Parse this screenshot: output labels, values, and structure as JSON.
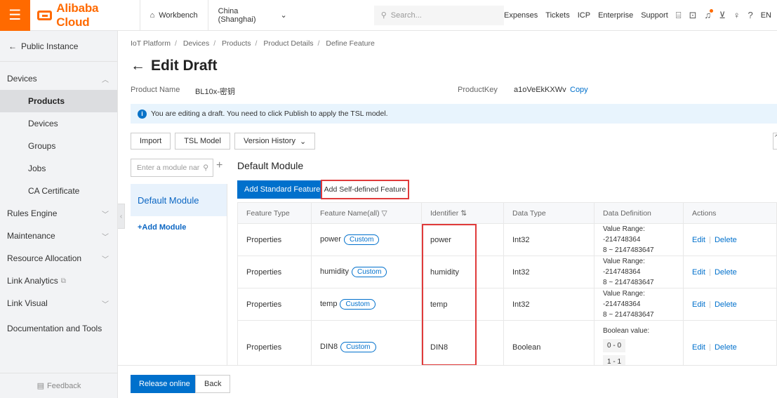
{
  "topbar": {
    "brand": "Alibaba Cloud",
    "workbench": "Workbench",
    "region": "China (Shanghai)",
    "search_placeholder": "Search...",
    "links": [
      "Expenses",
      "Tickets",
      "ICP",
      "Enterprise",
      "Support"
    ],
    "lang": "EN",
    "icons": [
      "code-icon",
      "terminal-icon",
      "bell-icon",
      "cart-icon",
      "lightbulb-icon",
      "help-icon"
    ]
  },
  "sidebar": {
    "back": "Public Instance",
    "groups": [
      {
        "label": "Devices",
        "expanded": true
      },
      {
        "label": "Rules Engine"
      },
      {
        "label": "Maintenance"
      },
      {
        "label": "Resource Allocation"
      },
      {
        "label": "Link Analytics"
      },
      {
        "label": "Link Visual"
      },
      {
        "label": "Documentation and Tools"
      }
    ],
    "sub_items": [
      "Products",
      "Devices",
      "Groups",
      "Jobs",
      "CA Certificate"
    ],
    "active_sub": "Products",
    "feedback": "Feedback"
  },
  "breadcrumb": [
    "IoT Platform",
    "Devices",
    "Products",
    "Product Details",
    "Define Feature"
  ],
  "page_title": "Edit Draft",
  "product": {
    "name_label": "Product Name",
    "name": "BL10x-密钥",
    "key_label": "ProductKey",
    "key": "a1oVeEkKXWv",
    "copy": "Copy"
  },
  "notice": "You are editing a draft. You need to click Publish to apply the TSL model.",
  "toolbar": {
    "import": "Import",
    "tsl_model": "TSL Model",
    "version_history": "Version History"
  },
  "modules": {
    "search_placeholder": "Enter a module nar",
    "active": "Default Module",
    "add": "+Add Module"
  },
  "module_content": {
    "title": "Default Module",
    "add_standard": "Add Standard Feature",
    "add_self_defined": "Add Self-defined Feature"
  },
  "table": {
    "headers": [
      "Feature Type",
      "Feature Name(all)",
      "Identifier",
      "Data Type",
      "Data Definition",
      "Actions"
    ],
    "rows": [
      {
        "type": "Properties",
        "name": "power",
        "tag": "Custom",
        "identifier": "power",
        "data_type": "Int32",
        "definition": "Value Range: -214748364",
        "definition2": "8 ~ 2147483647"
      },
      {
        "type": "Properties",
        "name": "humidity",
        "tag": "Custom",
        "identifier": "humidity",
        "data_type": "Int32",
        "definition": "Value Range: -214748364",
        "definition2": "8 ~ 2147483647"
      },
      {
        "type": "Properties",
        "name": "temp",
        "tag": "Custom",
        "identifier": "temp",
        "data_type": "Int32",
        "definition": "Value Range: -214748364",
        "definition2": "8 ~ 2147483647"
      },
      {
        "type": "Properties",
        "name": "DIN8",
        "tag": "Custom",
        "identifier": "DIN8",
        "data_type": "Boolean",
        "definition": "Boolean value:",
        "bool0": "0 - 0",
        "bool1": "1 - 1"
      }
    ],
    "edit": "Edit",
    "delete": "Delete"
  },
  "footer": {
    "release": "Release online",
    "back": "Back"
  },
  "colors": {
    "brand": "#ff6a00",
    "primary": "#0070cc",
    "highlight": "#e03a3a"
  }
}
